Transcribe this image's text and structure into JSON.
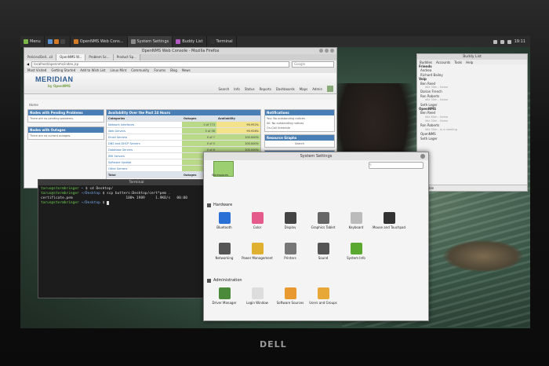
{
  "panel": {
    "menu_label": "Menu",
    "tasks": [
      {
        "label": "OpenNMS Web Cons..."
      },
      {
        "label": "System Settings"
      },
      {
        "label": "Buddy List"
      },
      {
        "label": "Terminal"
      }
    ],
    "clock": "19:11"
  },
  "firefox": {
    "title": "OpenNMS Web Console - Mozilla Firefox",
    "tabs": [
      {
        "label": "Policies/Dell...cil"
      },
      {
        "label": "OpenNMS W..."
      },
      {
        "label": "Problem Sc..."
      },
      {
        "label": "Product Sp..."
      }
    ],
    "url": "localhost/opennms/index.jsp",
    "search_placeholder": "Google",
    "bookmarks": [
      "Most Visited",
      "Getting Started",
      "Add to Wish List",
      "Linux Mint",
      "Community",
      "Forums",
      "Blog",
      "News"
    ],
    "logo": "MERIDIAN",
    "logo_sub": "by OpenNMS",
    "nav": [
      "Search",
      "Info",
      "Status",
      "Reports",
      "Dashboards",
      "Maps",
      "Admin"
    ],
    "breadcrumb": "Home",
    "left_panels": [
      {
        "title": "Nodes with Pending Problems",
        "body": "There are no pending problems."
      },
      {
        "title": "Nodes with Outages",
        "body": "There are no current outages."
      }
    ],
    "table": {
      "title": "Availability Over the Past 24 Hours",
      "headers": [
        "Categories",
        "Outages",
        "Availability"
      ],
      "rows": [
        {
          "category": "Network Interfaces",
          "outages": "0 of 773",
          "availability": "99.952%"
        },
        {
          "category": "Web Servers",
          "outages": "0 of 58",
          "availability": "99.926%"
        },
        {
          "category": "Email Servers",
          "outages": "0 of 7",
          "availability": "100.000%"
        },
        {
          "category": "DNS and DHCP Servers",
          "outages": "0 of 5",
          "availability": "100.000%"
        },
        {
          "category": "Database Servers",
          "outages": "0 of 6",
          "availability": "100.000%"
        },
        {
          "category": "JMX Servers",
          "outages": "0 of 5",
          "availability": "100.000%"
        },
        {
          "category": "Software Update",
          "outages": "0 of 37",
          "availability": "96.764%"
        },
        {
          "category": "Other Servers",
          "outages": "0 of 3",
          "availability": "100.000%"
        }
      ],
      "total": {
        "label": "Total",
        "outages": "Outages"
      },
      "footer": "Overall Service Availability"
    },
    "right_panels": [
      {
        "title": "Notifications",
        "lines": [
          "You: No outstanding notices",
          "All: No outstanding notices",
          "On-Call Schedule"
        ]
      },
      {
        "title": "Resource Graphs",
        "lines": [
          "Search"
        ]
      },
      {
        "title": "KSC Reports",
        "lines": [
          "Search"
        ]
      }
    ]
  },
  "terminal": {
    "title": "Terminal",
    "lines": [
      {
        "user": "tarus@stormbringer",
        "path": "~",
        "cmd": " $ cd Desktop/"
      },
      {
        "user": "tarus@stormbringer",
        "path": "~/Desktop",
        "cmd": " $ scp butters:Desktop/cert*pem ."
      },
      {
        "plain": "certificate.pem                         100% 1989     1.9KB/s   00:00"
      },
      {
        "user": "tarus@stormbringer",
        "path": "~/Desktop",
        "cmd": " $ "
      }
    ]
  },
  "buddy": {
    "title": "Buddy List",
    "menu": [
      "Buddies",
      "Accounts",
      "Tools",
      "Help"
    ],
    "rows": [
      {
        "text": "Friends",
        "kind": "grp"
      },
      {
        "text": "Andrea",
        "kind": "row"
      },
      {
        "text": "Richard Bailey",
        "kind": "row"
      },
      {
        "text": "Voip",
        "kind": "grp"
      },
      {
        "text": "Ben Reed",
        "kind": "row"
      },
      {
        "text": "Idle 30m - Home",
        "kind": "sub"
      },
      {
        "text": "Darian French",
        "kind": "row"
      },
      {
        "text": "Ron Roberts",
        "kind": "row"
      },
      {
        "text": "Idle 30m - Home",
        "kind": "sub"
      },
      {
        "text": "Seth Leger",
        "kind": "row"
      },
      {
        "text": "OpenNMS",
        "kind": "grp"
      },
      {
        "text": "Ben Reed",
        "kind": "row"
      },
      {
        "text": "Idle 60m - Home",
        "kind": "sub"
      },
      {
        "text": "Idle 30m - Home",
        "kind": "sub"
      },
      {
        "text": "Ron Roberts",
        "kind": "row"
      },
      {
        "text": "Idle 30m - In a meeting",
        "kind": "sub"
      },
      {
        "text": "OpenNMS",
        "kind": "row"
      },
      {
        "text": "Seth Leger",
        "kind": "row"
      }
    ],
    "status": "Available"
  },
  "settings": {
    "title": "System Settings",
    "top_item": "Workspaces",
    "sections": {
      "hardware": "Hardware",
      "administration": "Administration"
    },
    "hardware_row1": [
      {
        "label": "Bluetooth",
        "icon": "bluetooth-icon",
        "color": "#2a6fd6"
      },
      {
        "label": "Color",
        "icon": "color-icon",
        "color": "#e45a8a"
      },
      {
        "label": "Display",
        "icon": "display-icon",
        "color": "#444444"
      },
      {
        "label": "Graphics Tablet",
        "icon": "tablet-icon",
        "color": "#666666"
      },
      {
        "label": "Keyboard",
        "icon": "keyboard-icon",
        "color": "#bbbbbb"
      },
      {
        "label": "Mouse and Touchpad",
        "icon": "mouse-icon",
        "color": "#333333"
      }
    ],
    "hardware_row2": [
      {
        "label": "Networking",
        "icon": "network-icon",
        "color": "#555555"
      },
      {
        "label": "Power Management",
        "icon": "power-icon",
        "color": "#e0b030"
      },
      {
        "label": "Printers",
        "icon": "printer-icon",
        "color": "#777777"
      },
      {
        "label": "Sound",
        "icon": "sound-icon",
        "color": "#555555"
      },
      {
        "label": "System Info",
        "icon": "info-icon",
        "color": "#5aa82f"
      }
    ],
    "admin_row": [
      {
        "label": "Driver Manager",
        "icon": "driver-icon",
        "color": "#4a8a3a"
      },
      {
        "label": "Login Window",
        "icon": "login-icon",
        "color": "#dddddd"
      },
      {
        "label": "Software Sources",
        "icon": "sources-icon",
        "color": "#e89a30"
      },
      {
        "label": "Users and Groups",
        "icon": "users-icon",
        "color": "#e8a838"
      }
    ]
  },
  "bezel_logo": "DELL"
}
